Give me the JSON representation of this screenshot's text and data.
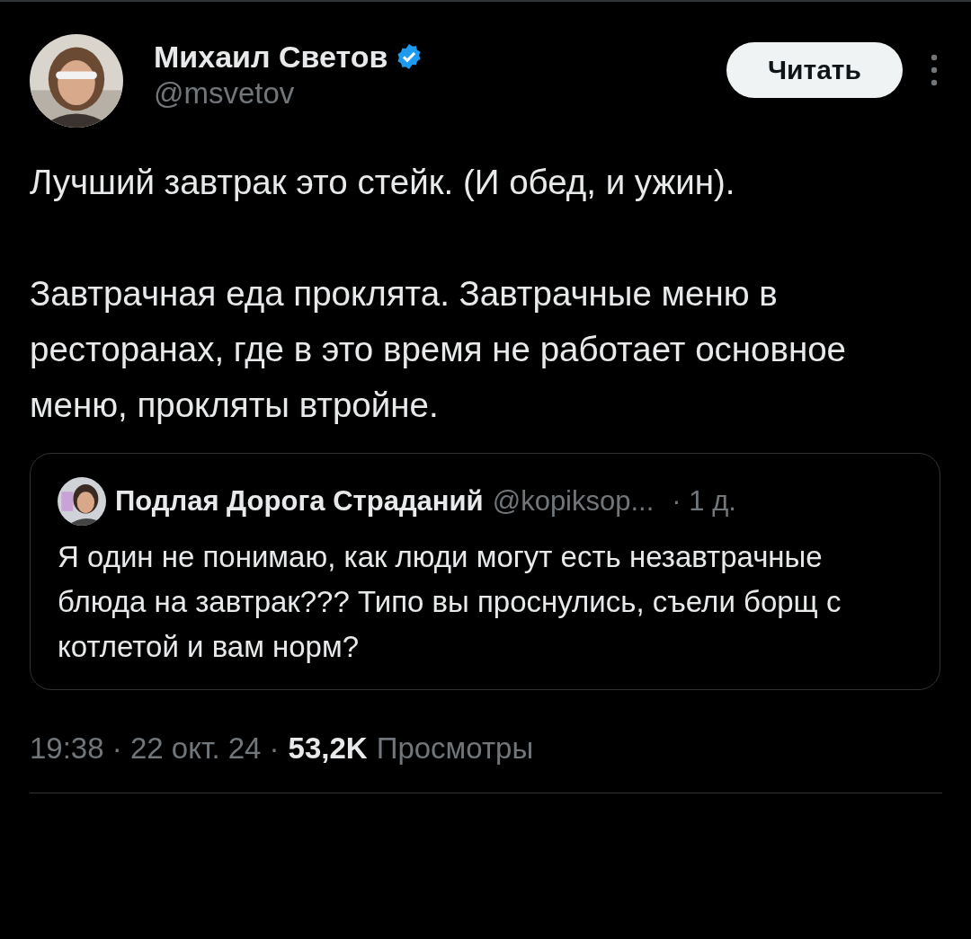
{
  "author": {
    "name": "Михаил Светов",
    "verified": true,
    "handle": "@msvetov"
  },
  "follow_button": "Читать",
  "text": [
    "Лучший завтрак это стейк. (И обед, и ужин).",
    "Завтрачная еда проклята. Завтрачные меню в ресторанах, где в это время не работает основное меню, прокляты втройне."
  ],
  "quote": {
    "name": "Подлая Дорога Страданий",
    "handle": "@kopiksop...",
    "time": "· 1 д.",
    "text": "Я один не понимаю, как люди могут есть незавтрачные блюда на завтрак??? Типо вы проснулись, съели борщ с котлетой и вам норм?"
  },
  "footer": {
    "meta": "19:38 · 22 окт. 24 ·",
    "views": "53,2K",
    "views_label": "Просмотры"
  }
}
